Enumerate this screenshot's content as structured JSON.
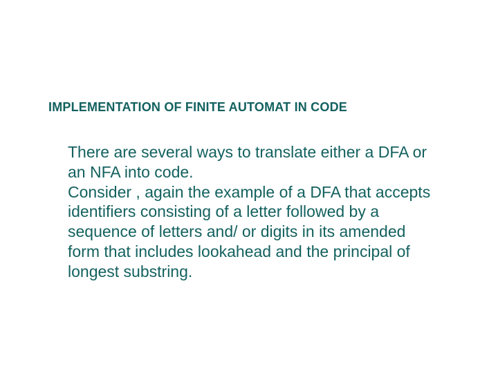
{
  "heading": "IMPLEMENTATION OF FINITE AUTOMAT IN CODE",
  "paragraph1": "There are several ways to translate either a DFA or an NFA  into code.",
  "paragraph2": " Consider , again the example of a DFA that accepts identifiers consisting of a letter followed by a sequence of letters and/ or digits in its amended form that includes lookahead and the principal of longest substring."
}
